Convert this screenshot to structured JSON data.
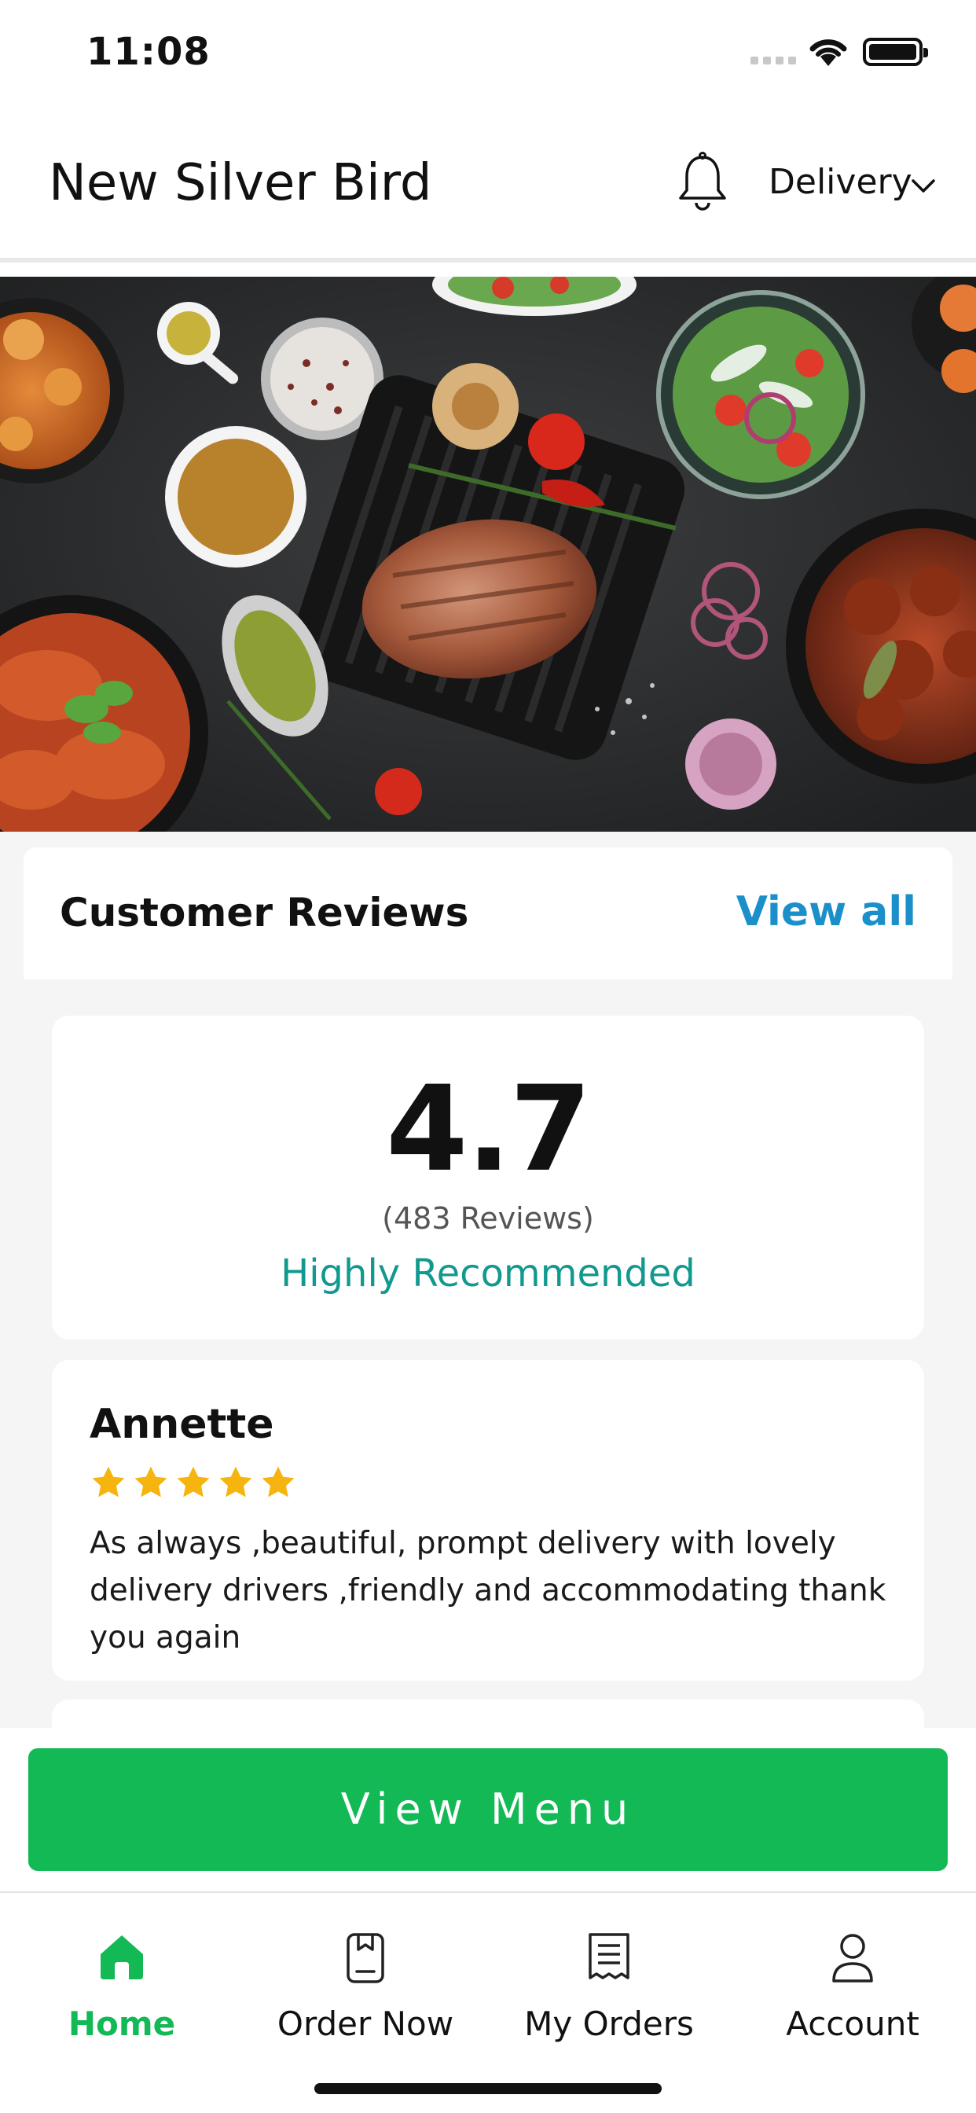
{
  "status_bar": {
    "time": "11:08"
  },
  "header": {
    "title": "New Silver Bird",
    "notification_icon": "bell-icon",
    "order_mode": "Delivery",
    "order_mode_icon": "chevron-down-icon"
  },
  "hero": {
    "image": "food-spread-photo"
  },
  "reviews": {
    "title": "Customer Reviews",
    "view_all": "View all",
    "rating": "4.7",
    "count_text": "(483 Reviews)",
    "recommendation": "Highly Recommended",
    "items": [
      {
        "name": "Annette",
        "stars": 5,
        "text": "As always ,beautiful, prompt delivery with lovely delivery drivers ,friendly and accommodating thank you again"
      }
    ]
  },
  "cta": {
    "label": "View Menu"
  },
  "tabbar": {
    "items": [
      {
        "label": "Home",
        "icon": "home-icon",
        "active": true
      },
      {
        "label": "Order Now",
        "icon": "order-icon",
        "active": false
      },
      {
        "label": "My Orders",
        "icon": "receipt-icon",
        "active": false
      },
      {
        "label": "Account",
        "icon": "account-icon",
        "active": false
      }
    ]
  },
  "colors": {
    "accent_green": "#13b955",
    "link_blue": "#1a8fc9",
    "teal": "#12998f",
    "star": "#f6b40f"
  }
}
